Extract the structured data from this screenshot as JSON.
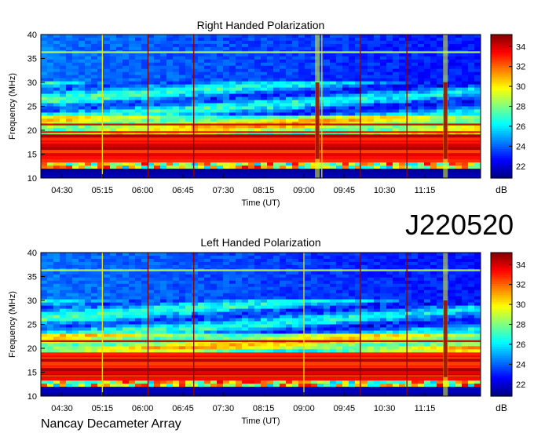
{
  "chart_data": [
    {
      "type": "heatmap",
      "title": "Right Handed Polarization",
      "xlabel": "Time (UT)",
      "ylabel": "Frequency (MHz)",
      "x_ticks": [
        "04:30",
        "05:15",
        "06:00",
        "06:45",
        "07:30",
        "08:15",
        "09:00",
        "09:45",
        "10:30",
        "11:15"
      ],
      "y_ticks": [
        "10",
        "15",
        "20",
        "25",
        "30",
        "35",
        "40"
      ],
      "ylim": [
        10,
        40
      ],
      "colorbar": {
        "label": "dB",
        "ticks": [
          "22",
          "24",
          "26",
          "28",
          "30",
          "32",
          "34"
        ],
        "range": [
          20.8,
          35.2
        ],
        "colormap": "jet"
      },
      "features": {
        "bright_band_MHz": [
          13,
          19
        ],
        "interference_lines_MHz": [
          36.3,
          21.2,
          19.6,
          17.4,
          15.6
        ],
        "vertical_markers": [
          "05:15",
          "06:06",
          "06:57",
          "09:20",
          "10:03",
          "10:55"
        ],
        "burst_times": [
          "09:15",
          "11:38"
        ]
      }
    },
    {
      "type": "heatmap",
      "title": "Left Handed Polarization",
      "xlabel": "Time (UT)",
      "ylabel": "Frequency (MHz)",
      "x_ticks": [
        "04:30",
        "05:15",
        "06:00",
        "06:45",
        "07:30",
        "08:15",
        "09:00",
        "09:45",
        "10:30",
        "11:15"
      ],
      "y_ticks": [
        "10",
        "15",
        "20",
        "25",
        "30",
        "35",
        "40"
      ],
      "ylim": [
        10,
        40
      ],
      "colorbar": {
        "label": "dB",
        "ticks": [
          "22",
          "24",
          "26",
          "28",
          "30",
          "32",
          "34"
        ],
        "range": [
          20.8,
          35.2
        ],
        "colormap": "jet"
      },
      "features": {
        "bright_band_MHz": [
          13,
          19
        ],
        "interference_lines_MHz": [
          36.3,
          21.5,
          18.3,
          16.2,
          14.2
        ],
        "vertical_markers": [
          "05:15",
          "06:06",
          "06:57",
          "09:00",
          "10:03",
          "10:55"
        ],
        "burst_times": [
          "11:38"
        ]
      }
    }
  ],
  "labels": {
    "observation_id": "J220520",
    "instrument": "Nancay Decameter Array"
  },
  "colors": {
    "background": "#ffffff",
    "axis": "#000000"
  }
}
